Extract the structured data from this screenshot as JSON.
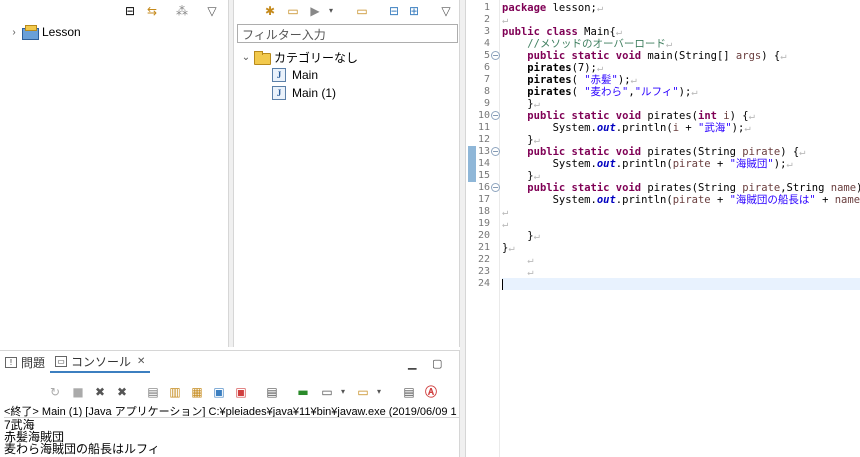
{
  "package_explorer": {
    "toolbar_icons": [
      "collapse-all-icon",
      "link-editor-icon",
      "view-menu-icon",
      "chevron-down-icon"
    ],
    "items": [
      {
        "label": "Lesson",
        "icon": "java-project-icon",
        "expanded": false
      }
    ]
  },
  "outline": {
    "filter_placeholder": "フィルター入力",
    "category_label": "カテゴリーなし",
    "items": [
      {
        "label": "Main"
      },
      {
        "label": "Main (1)"
      }
    ]
  },
  "editor": {
    "line_numbers": [
      "1",
      "2",
      "3",
      "4",
      "5",
      "6",
      "7",
      "8",
      "9",
      "10",
      "11",
      "12",
      "13",
      "14",
      "15",
      "16",
      "17",
      "18",
      "19",
      "20",
      "21",
      "22",
      "23",
      "24"
    ],
    "current_line": 24
  },
  "console": {
    "tabs": [
      {
        "label": "問題",
        "active": false
      },
      {
        "label": "コンソール",
        "active": true
      }
    ],
    "header": "<終了> Main (1) [Java アプリケーション] C:¥pleiades¥java¥11¥bin¥javaw.exe (2019/06/09 1",
    "output": [
      "7武海",
      "赤髪海賊団",
      "麦わら海賊団の船長はルフィ"
    ]
  },
  "colors": {
    "keyword": "#7f0055",
    "string": "#2a00ff",
    "comment": "#3f7f5f",
    "field": "#0000c0",
    "current_line": "#e8f2fe"
  }
}
